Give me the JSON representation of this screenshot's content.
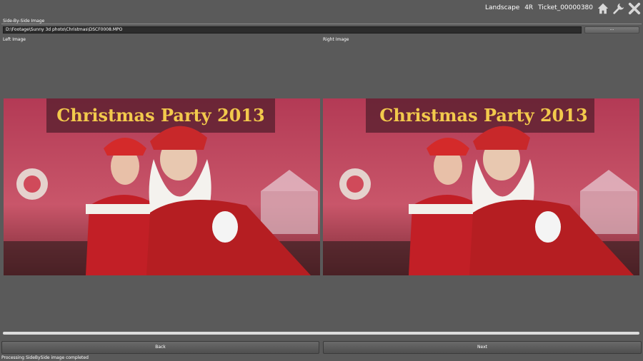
{
  "titlebar": {
    "orientation": "Landscape",
    "print_size": "4R",
    "ticket": "Ticket_00000380",
    "buttons": [
      {
        "icon": "home-icon"
      },
      {
        "icon": "settings-icon"
      },
      {
        "icon": "close-icon"
      }
    ]
  },
  "panel": {
    "title": "Side-By-Side Image",
    "file_path": "D:\\Footage\\Sunny 3d photo\\Christmas\\DSCF0008.MPO",
    "browse_label": "...",
    "left_label": "Left Image",
    "right_label": "Right Image"
  },
  "banner": {
    "left_text": "Christmas Party 2013",
    "right_text": "Christmas Party 2013"
  },
  "navigation": {
    "back_label": "Back",
    "next_label": "Next"
  },
  "status": {
    "message": "Processing SideBySide image completed"
  },
  "colors": {
    "background": "#5a5a5a",
    "field": "#2c2c2c",
    "banner_text": "#f2c94c",
    "backdrop": "#c0485e"
  }
}
